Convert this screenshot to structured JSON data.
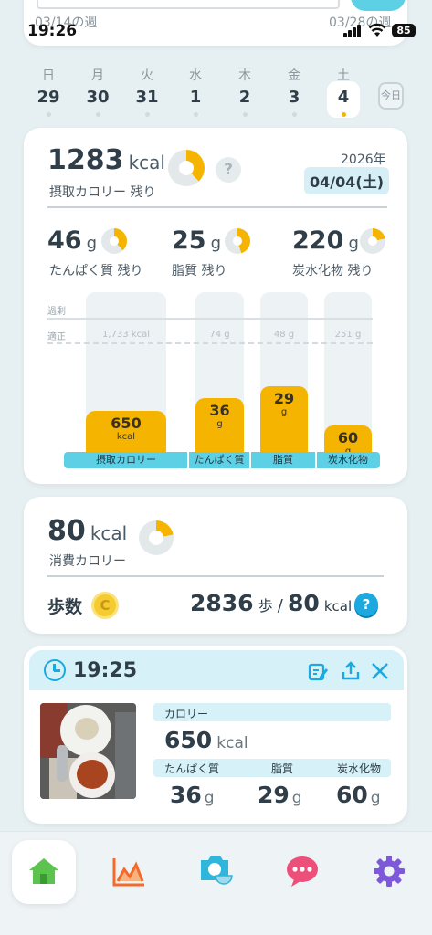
{
  "status_bar": {
    "time": "19:26",
    "battery": "85"
  },
  "top_card": {
    "week_left": "03/14の週",
    "week_right": "03/28の週"
  },
  "week": {
    "days": [
      {
        "dow": "日",
        "num": "29"
      },
      {
        "dow": "月",
        "num": "30"
      },
      {
        "dow": "火",
        "num": "31"
      },
      {
        "dow": "水",
        "num": "1"
      },
      {
        "dow": "木",
        "num": "2"
      },
      {
        "dow": "金",
        "num": "3"
      },
      {
        "dow": "土",
        "num": "4"
      }
    ],
    "today_label": "今日"
  },
  "summary": {
    "kcal": "1283",
    "kcal_unit": "kcal",
    "kcal_label": "摂取カロリー 残り",
    "help": "?",
    "year": "2026年",
    "date": "04/04(土)",
    "macros": [
      {
        "value": "46",
        "unit": "g",
        "label": "たんぱく質 残り"
      },
      {
        "value": "25",
        "unit": "g",
        "label": "脂質 残り"
      },
      {
        "value": "220",
        "unit": "g",
        "label": "炭水化物 残り"
      }
    ]
  },
  "bars": {
    "over_label": "過剰",
    "ok_label": "適正",
    "columns": [
      {
        "category": "摂取カロリー",
        "value": "650",
        "unit": "kcal",
        "target": "1,733",
        "target_unit": "kcal",
        "fraction": 0.375
      },
      {
        "category": "たんぱく質",
        "value": "36",
        "unit": "g",
        "target": "74",
        "target_unit": "g",
        "fraction": 0.49
      },
      {
        "category": "脂質",
        "value": "29",
        "unit": "g",
        "target": "48",
        "target_unit": "g",
        "fraction": 0.6
      },
      {
        "category": "炭水化物",
        "value": "60",
        "unit": "g",
        "target": "251",
        "target_unit": "g",
        "fraction": 0.24
      }
    ]
  },
  "burn": {
    "kcal": "80",
    "kcal_unit": "kcal",
    "label": "消費カロリー",
    "steps_label": "歩数",
    "coin": "C",
    "steps": "2836",
    "steps_unit": "歩",
    "sep": "/",
    "steps_kcal": "80",
    "steps_kcal_unit": "kcal",
    "help": "?"
  },
  "meal": {
    "time": "19:25",
    "kcal_label": "カロリー",
    "kcal": "650",
    "kcal_unit": "kcal",
    "cols": [
      {
        "label": "たんぱく質",
        "value": "36",
        "unit": "g"
      },
      {
        "label": "脂質",
        "value": "29",
        "unit": "g"
      },
      {
        "label": "炭水化物",
        "value": "60",
        "unit": "g"
      }
    ]
  },
  "nav": {
    "items": [
      "home-icon",
      "chart-icon",
      "camera-meal-icon",
      "chat-icon",
      "settings-icon"
    ]
  },
  "colors": {
    "accent": "#f5b400",
    "primary": "#5ed0e6",
    "blue": "#1ba9e0"
  }
}
